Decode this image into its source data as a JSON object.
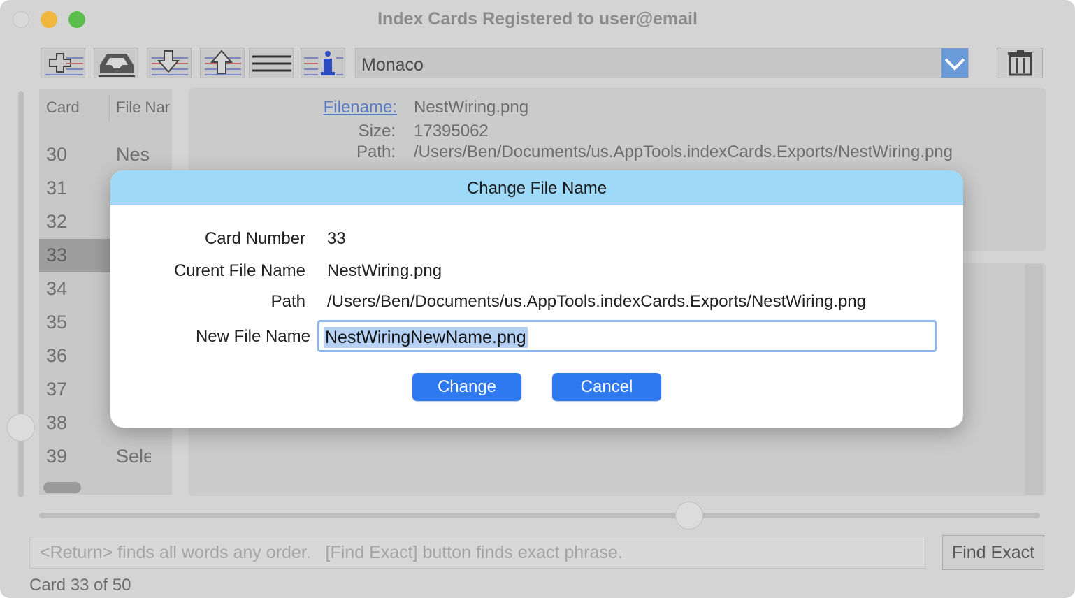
{
  "window": {
    "title": "Index Cards Registered to user@email"
  },
  "toolbar": {
    "font_value": "Monaco",
    "icons": [
      "add-card-icon",
      "inbox-icon",
      "import-icon",
      "export-icon",
      "text-lines-icon",
      "info-list-icon",
      "dropdown-arrow-icon",
      "trash-icon"
    ]
  },
  "table": {
    "headers": [
      "Card",
      "File Nar"
    ],
    "rows": [
      {
        "num": "30",
        "fn": "Nes"
      },
      {
        "num": "31",
        "fn": ""
      },
      {
        "num": "32",
        "fn": ""
      },
      {
        "num": "33",
        "fn": ""
      },
      {
        "num": "34",
        "fn": ""
      },
      {
        "num": "35",
        "fn": ""
      },
      {
        "num": "36",
        "fn": ""
      },
      {
        "num": "37",
        "fn": ""
      },
      {
        "num": "38",
        "fn": ""
      },
      {
        "num": "39",
        "fn": "Sele"
      }
    ]
  },
  "details": {
    "filename_label": "Filename:",
    "filename_value": "NestWiring.png",
    "size_label": "Size:",
    "size_value": "17395062",
    "path_label": "Path:",
    "path_value": "/Users/Ben/Documents/us.AppTools.indexCards.Exports/NestWiring.png"
  },
  "search": {
    "placeholder": "<Return> finds all words any order.   [Find Exact] button finds exact phrase.",
    "find_exact_label": "Find Exact"
  },
  "status": {
    "text": "Card 33 of 50"
  },
  "dialog": {
    "title": "Change File Name",
    "card_number_label": "Card Number",
    "card_number_value": "33",
    "current_label": "Curent File Name",
    "current_value": "NestWiring.png",
    "path_label": "Path",
    "path_value": "/Users/Ben/Documents/us.AppTools.indexCards.Exports/NestWiring.png",
    "new_label": "New File Name",
    "new_value": "NestWiringNewName.png",
    "change_label": "Change",
    "cancel_label": "Cancel"
  },
  "colors": {
    "dialog_header": "#9ed9f8",
    "primary_button": "#2f79f0",
    "selection": "#b6d1f3"
  }
}
